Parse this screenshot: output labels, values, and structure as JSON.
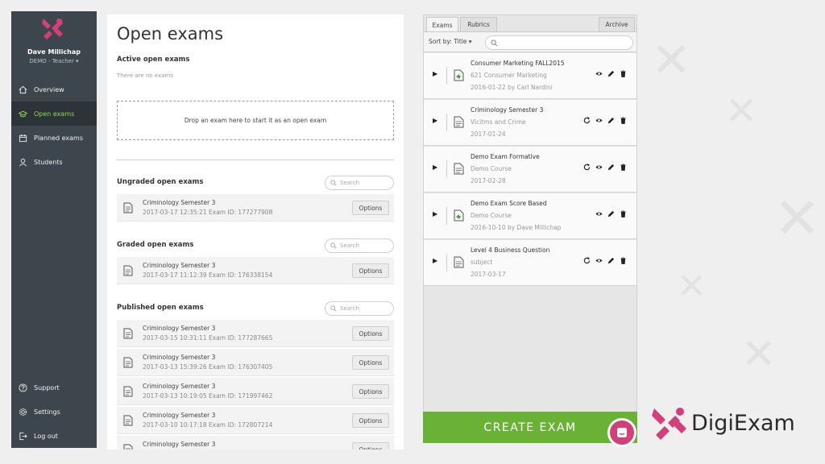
{
  "user": {
    "name": "Dave Millichap",
    "role": "DEMO - Teacher ▾"
  },
  "nav": {
    "items": [
      {
        "label": "Overview",
        "icon": "home-icon"
      },
      {
        "label": "Open exams",
        "icon": "graduation-cap-icon"
      },
      {
        "label": "Planned exams",
        "icon": "calendar-icon"
      },
      {
        "label": "Students",
        "icon": "students-icon"
      }
    ],
    "bottom": [
      {
        "label": "Support",
        "icon": "help-icon"
      },
      {
        "label": "Settings",
        "icon": "gear-icon"
      },
      {
        "label": "Log out",
        "icon": "logout-icon"
      }
    ]
  },
  "main": {
    "title": "Open exams",
    "active_title": "Active open exams",
    "no_exams": "There are no exams",
    "dropzone": "Drop an exam here to start it as an open exam",
    "search_placeholder": "Search",
    "options_label": "Options",
    "ungraded": {
      "title": "Ungraded open exams",
      "rows": [
        {
          "title": "Criminology Semester 3",
          "meta": "2017-03-17 12:35:21   Exam ID: 177277908"
        }
      ]
    },
    "graded": {
      "title": "Graded open exams",
      "rows": [
        {
          "title": "Criminology Semester 3",
          "meta": "2017-03-17 11:12:39   Exam ID: 176338154"
        }
      ]
    },
    "published": {
      "title": "Published open exams",
      "rows": [
        {
          "title": "Criminology Semester 3",
          "meta": "2017-03-15 10:31:11   Exam ID: 177287665"
        },
        {
          "title": "Criminology Semester 3",
          "meta": "2017-03-13 15:39:26   Exam ID: 176307405"
        },
        {
          "title": "Criminology Semester 3",
          "meta": "2017-03-13 10:19:05   Exam ID: 171997462"
        },
        {
          "title": "Criminology Semester 3",
          "meta": "2017-03-10 10:17:18   Exam ID: 172807214"
        },
        {
          "title": "Criminology Semester 3",
          "meta": ""
        }
      ]
    }
  },
  "right": {
    "tabs": {
      "exams": "Exams",
      "rubrics": "Rubrics",
      "archive": "Archive"
    },
    "sort_label": "Sort by: Title ▾",
    "exams": [
      {
        "title": "Consumer Marketing FALL2015",
        "sub": "621 Consumer Marketing",
        "date": "2016-01-22 by Carl Nardini",
        "icon": "shared-doc-icon",
        "share": false
      },
      {
        "title": "Criminology Semester 3",
        "sub": "Vicitms and Crime",
        "date": "2017-01-24",
        "icon": "doc-icon",
        "share": true
      },
      {
        "title": "Demo Exam Formative",
        "sub": "Demo Course",
        "date": "2017-02-28",
        "icon": "doc-icon",
        "share": true
      },
      {
        "title": "Demo Exam Score Based",
        "sub": "Demo Course",
        "date": "2016-10-10 by Dave Millichap",
        "icon": "shared-doc-icon",
        "share": false
      },
      {
        "title": "Level 4 Business Question",
        "sub": "subject",
        "date": "2017-03-17",
        "icon": "doc-icon",
        "share": true
      }
    ],
    "create_label": "CREATE EXAM"
  },
  "brand": {
    "name": "DigiExam",
    "accent": "#d43f7a",
    "green": "#6ab235"
  }
}
